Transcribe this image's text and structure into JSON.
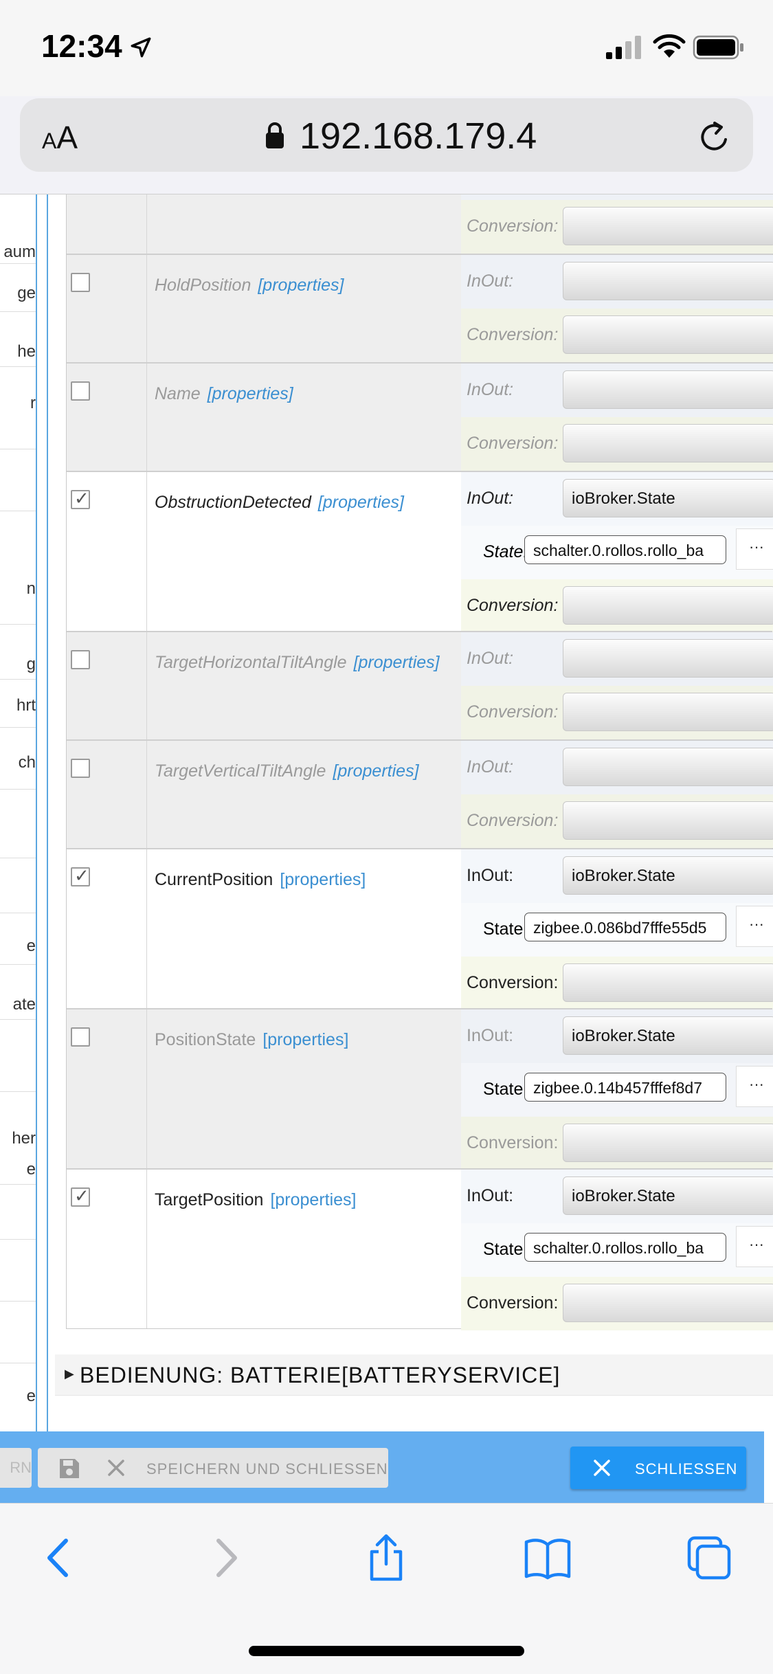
{
  "status_bar": {
    "time": "12:34",
    "icons": [
      "location-arrow-icon",
      "cellular-signal-icon",
      "wifi-icon",
      "battery-icon"
    ]
  },
  "browser": {
    "text_size_label": "AA",
    "url": "192.168.179.4"
  },
  "left_sidebar_fragments": [
    "aum",
    "ge",
    "he",
    "r",
    "n",
    "g",
    "hrt",
    "ch",
    "e",
    "ate",
    "her",
    "e",
    "e"
  ],
  "characteristics": [
    {
      "name": "",
      "enabled": false,
      "link": "",
      "fields": [
        {
          "label": "Conversion:",
          "value": ""
        }
      ]
    },
    {
      "name": "HoldPosition",
      "enabled": false,
      "link": "[properties]",
      "fields": [
        {
          "label": "InOut:",
          "value": ""
        },
        {
          "label": "Conversion:",
          "value": ""
        }
      ]
    },
    {
      "name": "Name",
      "enabled": false,
      "link": "[properties]",
      "fields": [
        {
          "label": "InOut:",
          "value": ""
        },
        {
          "label": "Conversion:",
          "value": ""
        }
      ]
    },
    {
      "name": "ObstructionDetected",
      "enabled": true,
      "link": "[properties]",
      "fields": [
        {
          "label": "InOut:",
          "value": "ioBroker.State"
        },
        {
          "label": "State:",
          "value": "schalter.0.rollos.rollo_ba"
        },
        {
          "label": "Conversion:",
          "value": ""
        }
      ]
    },
    {
      "name": "TargetHorizontalTiltAngle",
      "enabled": false,
      "link": "[properties]",
      "fields": [
        {
          "label": "InOut:",
          "value": ""
        },
        {
          "label": "Conversion:",
          "value": ""
        }
      ]
    },
    {
      "name": "TargetVerticalTiltAngle",
      "enabled": false,
      "link": "[properties]",
      "fields": [
        {
          "label": "InOut:",
          "value": ""
        },
        {
          "label": "Conversion:",
          "value": ""
        }
      ]
    },
    {
      "name": "CurrentPosition",
      "enabled": true,
      "link": "[properties]",
      "fields": [
        {
          "label": "InOut:",
          "value": "ioBroker.State"
        },
        {
          "label": "State:",
          "value": "zigbee.0.086bd7fffe55d5"
        },
        {
          "label": "Conversion:",
          "value": ""
        }
      ]
    },
    {
      "name": "PositionState",
      "enabled": false,
      "link": "[properties]",
      "fields": [
        {
          "label": "InOut:",
          "value": "ioBroker.State"
        },
        {
          "label": "State:",
          "value": "zigbee.0.14b457fffef8d7"
        },
        {
          "label": "Conversion:",
          "value": ""
        }
      ]
    },
    {
      "name": "TargetPosition",
      "enabled": true,
      "link": "[properties]",
      "fields": [
        {
          "label": "InOut:",
          "value": "ioBroker.State"
        },
        {
          "label": "State:",
          "value": "schalter.0.rollos.rollo_ba"
        },
        {
          "label": "Conversion:",
          "value": ""
        }
      ]
    }
  ],
  "state_picker_label": "···",
  "section": {
    "title": "BEDIENUNG: BATTERIE[BATTERYSERVICE]"
  },
  "dialog_toolbar": {
    "partial_button_label": "RN",
    "save_close_label": "SPEICHERN UND SCHLIESSEN",
    "close_label": "SCHLIESSEN",
    "accent_color": "#2196f3",
    "bar_color": "#64aef0"
  },
  "safari_toolbar": {
    "icons": [
      "back-chevron-icon",
      "forward-chevron-icon",
      "share-icon",
      "bookmarks-icon",
      "tabs-icon"
    ]
  }
}
